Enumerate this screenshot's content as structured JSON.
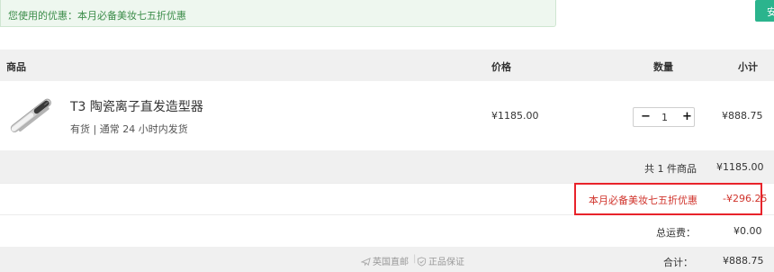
{
  "promo": {
    "label": "您使用的优惠：",
    "text": "本月必备美妆七五折优惠",
    "top_button_partial": "安"
  },
  "table": {
    "headers": {
      "product": "商品",
      "price": "价格",
      "quantity": "数量",
      "subtotal": "小计"
    }
  },
  "product": {
    "name": "T3 陶瓷离子直发造型器",
    "stock": "有货 | 通常 24 小时内发货",
    "price": "¥1185.00",
    "quantity": "1",
    "subtotal": "¥888.75",
    "image_icon": "hair-straightener-image"
  },
  "summary": {
    "count_label": "共 1 件商品",
    "count_value": "¥1185.00",
    "discount_label": "本月必备美妆七五折优惠",
    "discount_value": "-¥296.25",
    "shipping_label": "总运费：",
    "shipping_value": "¥0.00",
    "total_label": "合计：",
    "total_value": "¥888.75"
  },
  "badges": {
    "direct_mail": "英国直邮",
    "authentic": "正品保证"
  },
  "colors": {
    "accent_green": "#2bb48d",
    "promo_text": "#3c8d4a",
    "discount_red": "#d0342c",
    "highlight_border": "#e8232b"
  }
}
